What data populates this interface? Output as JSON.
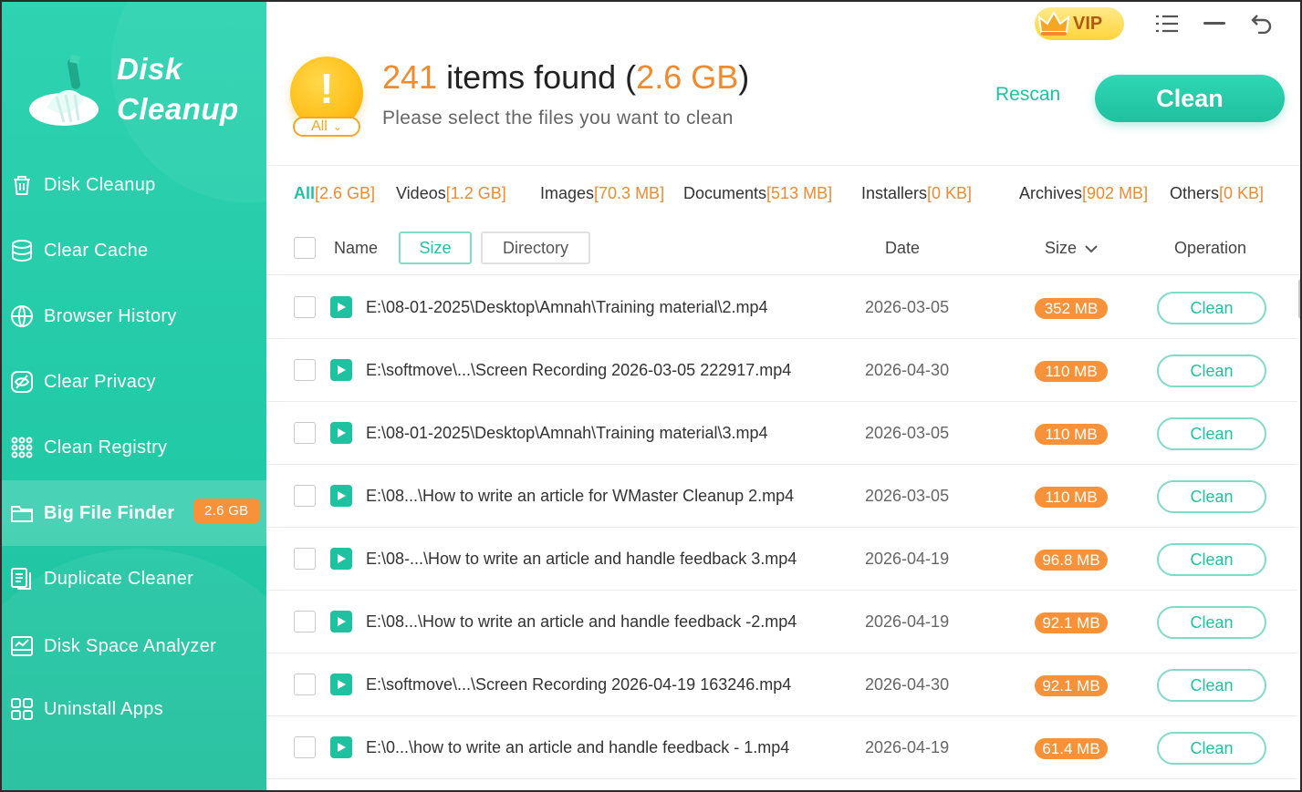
{
  "app": {
    "name_line1": "Disk",
    "name_line2": "Cleanup",
    "accent_color": "#22c9a6",
    "warning_color": "#f08a2c"
  },
  "sidebar": {
    "items": [
      {
        "label": "Disk Cleanup",
        "icon": "trash-icon"
      },
      {
        "label": "Clear Cache",
        "icon": "database-icon"
      },
      {
        "label": "Browser History",
        "icon": "globe-icon"
      },
      {
        "label": "Clear Privacy",
        "icon": "eye-off-icon"
      },
      {
        "label": "Clean Registry",
        "icon": "grid-dots-icon"
      },
      {
        "label": "Big File Finder",
        "icon": "folder-icon",
        "badge": "2.6 GB",
        "active": true
      },
      {
        "label": "Duplicate Cleaner",
        "icon": "duplicate-icon"
      },
      {
        "label": "Disk Space Analyzer",
        "icon": "chart-icon"
      },
      {
        "label": "Uninstall Apps",
        "icon": "apps-icon"
      }
    ]
  },
  "header": {
    "vip_label": "VIP",
    "scope_label": "All",
    "count": "241",
    "count_text": " items found (",
    "total_size": "2.6 GB",
    "close_paren": ")",
    "subtitle": "Please select the files you want to clean",
    "rescan_label": "Rescan",
    "clean_label": "Clean"
  },
  "filters": [
    {
      "label": "All",
      "amount": "[2.6 GB]",
      "active": true
    },
    {
      "label": "Videos",
      "amount": "[1.2 GB]"
    },
    {
      "label": "Images",
      "amount": "[70.3 MB]"
    },
    {
      "label": "Documents",
      "amount": "[513 MB]"
    },
    {
      "label": "Installers",
      "amount": "[0 KB]"
    },
    {
      "label": "Archives",
      "amount": "[902 MB]"
    },
    {
      "label": "Others",
      "amount": "[0 KB]"
    }
  ],
  "table": {
    "col_name": "Name",
    "sort_size": "Size",
    "sort_directory": "Directory",
    "col_date": "Date",
    "col_size": "Size",
    "col_operation": "Operation",
    "row_action": "Clean",
    "rows": [
      {
        "path": "E:\\08-01-2025\\Desktop\\Amnah\\Training material\\2.mp4",
        "date": "2026-03-05",
        "size": "352 MB"
      },
      {
        "path": "E:\\softmove\\...\\Screen Recording 2026-03-05 222917.mp4",
        "date": "2026-04-30",
        "size": "110 MB"
      },
      {
        "path": "E:\\08-01-2025\\Desktop\\Amnah\\Training material\\3.mp4",
        "date": "2026-03-05",
        "size": "110 MB"
      },
      {
        "path": "E:\\08...\\How to write an article for WMaster Cleanup 2.mp4",
        "date": "2026-03-05",
        "size": "110 MB"
      },
      {
        "path": "E:\\08-...\\How to write an article and handle feedback 3.mp4",
        "date": "2026-04-19",
        "size": "96.8 MB"
      },
      {
        "path": "E:\\08...\\How to write an article and handle feedback -2.mp4",
        "date": "2026-04-19",
        "size": "92.1 MB"
      },
      {
        "path": "E:\\softmove\\...\\Screen Recording 2026-04-19 163246.mp4",
        "date": "2026-04-30",
        "size": "92.1 MB"
      },
      {
        "path": "E:\\0...\\how to write an article and handle feedback - 1.mp4",
        "date": "2026-04-19",
        "size": "61.4 MB"
      }
    ]
  }
}
